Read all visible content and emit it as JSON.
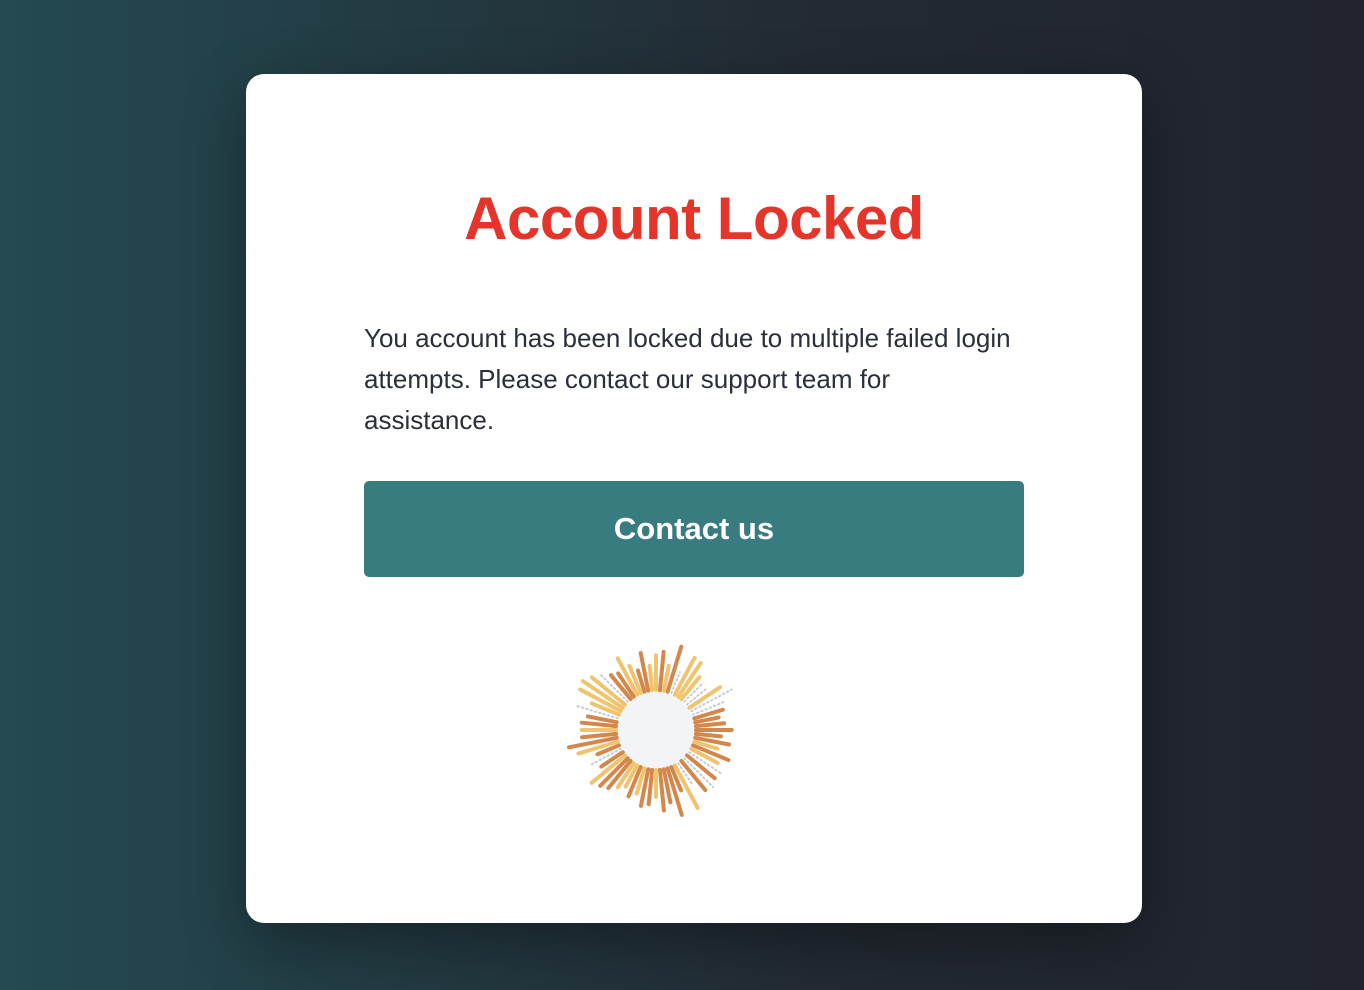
{
  "dialog": {
    "title": "Account Locked",
    "message": "You account has been locked due to multiple failed login attempts. Please contact our support team for assistance.",
    "contact_label": "Contact us"
  },
  "colors": {
    "title": "#e5352a",
    "button": "#387c7f",
    "spinner_dark": "#d4874a",
    "spinner_light": "#f0c46e",
    "spinner_dots": "#c8ccd2",
    "spinner_center": "#f3f4f8"
  },
  "icons": {
    "loading": "sunburst-spinner-icon"
  }
}
